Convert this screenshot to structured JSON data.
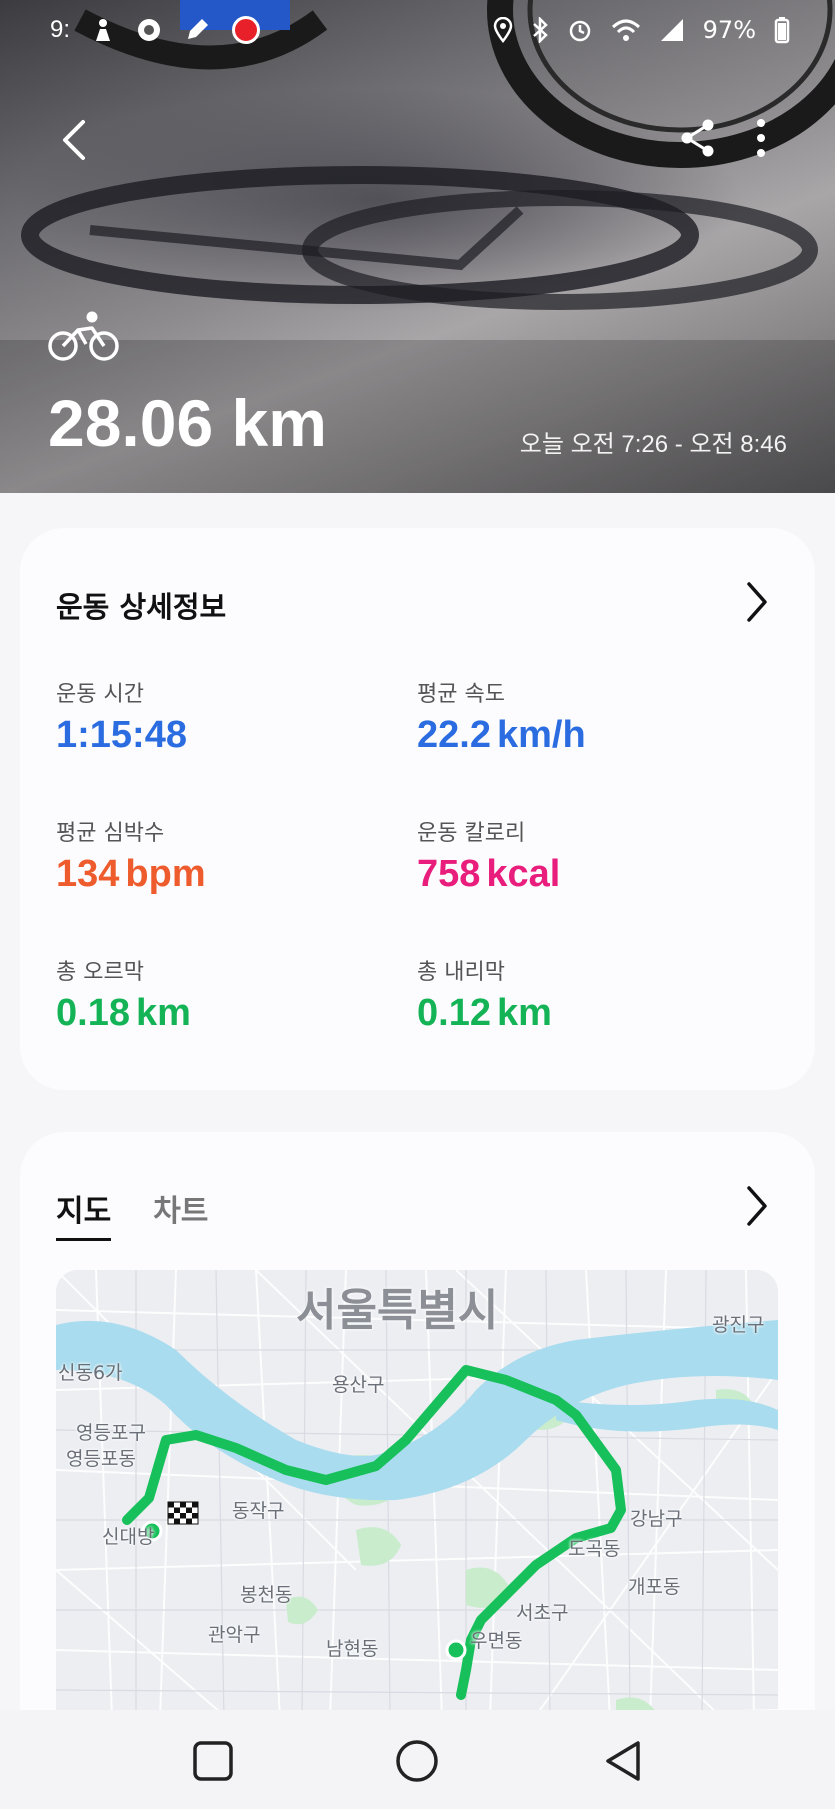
{
  "status_bar": {
    "time": "9:",
    "battery": "97%",
    "icons_left": [
      "person-icon",
      "circle-record-icon",
      "pen-icon",
      "record-dot-icon"
    ],
    "icons_right": [
      "location-icon",
      "bluetooth-icon",
      "alarm-icon",
      "wifi-icon",
      "signal-icon",
      "battery-icon"
    ]
  },
  "header": {
    "distance": "28.06 km",
    "time_range": "오늘 오전 7:26 - 오전 8:46",
    "activity_icon": "cycling-icon"
  },
  "details": {
    "title": "운동 상세정보",
    "stats": [
      {
        "label": "운동 시간",
        "value": "1:15:48",
        "unit": "",
        "color": "#2b6ce0"
      },
      {
        "label": "평균 속도",
        "value": "22.2",
        "unit": "km/h",
        "color": "#2b6ce0"
      },
      {
        "label": "평균 심박수",
        "value": "134",
        "unit": "bpm",
        "color": "#ee5b2c"
      },
      {
        "label": "운동 칼로리",
        "value": "758",
        "unit": "kcal",
        "color": "#e81d7c"
      },
      {
        "label": "총 오르막",
        "value": "0.18",
        "unit": "km",
        "color": "#14b356"
      },
      {
        "label": "총 내리막",
        "value": "0.12",
        "unit": "km",
        "color": "#14b356"
      }
    ]
  },
  "map_section": {
    "tabs": [
      "지도",
      "차트"
    ],
    "active_tab": "지도",
    "map_title": "서울특별시",
    "labels": [
      "광진구",
      "용산구",
      "영등포구",
      "영등포동",
      "동작구",
      "신대방",
      "강남구",
      "도곡동",
      "개포동",
      "봉천동",
      "관악구",
      "남현동",
      "서초구",
      "우면동",
      "신동6가"
    ]
  },
  "colors": {
    "route": "#17c05a",
    "river": "#a9dcee",
    "park": "#c9eccd"
  }
}
